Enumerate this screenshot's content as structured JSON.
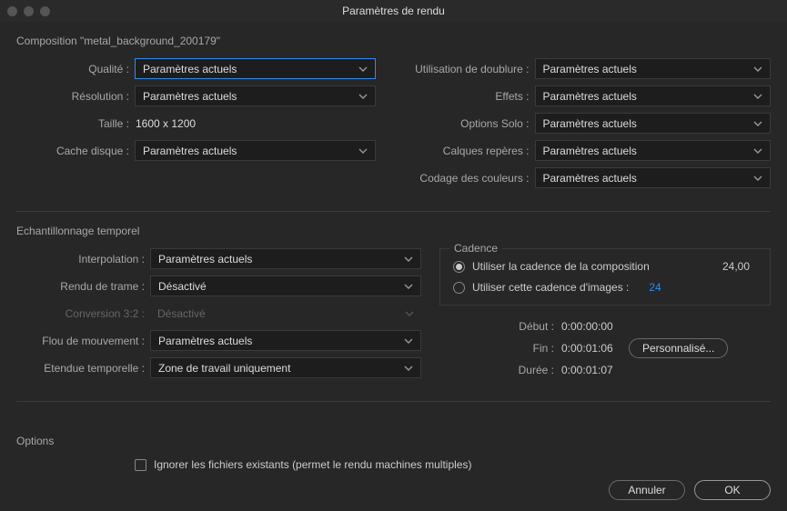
{
  "window_title": "Paramètres de rendu",
  "composition_label": "Composition \"metal_background_200179\"",
  "left_section": {
    "quality_label": "Qualité :",
    "quality_value": "Paramètres actuels",
    "resolution_label": "Résolution :",
    "resolution_value": "Paramètres actuels",
    "size_label": "Taille :",
    "size_value": "1600 x 1200",
    "disk_cache_label": "Cache disque :",
    "disk_cache_value": "Paramètres actuels"
  },
  "right_section": {
    "proxy_label": "Utilisation de doublure :",
    "proxy_value": "Paramètres actuels",
    "effects_label": "Effets :",
    "effects_value": "Paramètres actuels",
    "solo_label": "Options Solo :",
    "solo_value": "Paramètres actuels",
    "guides_label": "Calques repères :",
    "guides_value": "Paramètres actuels",
    "color_label": "Codage des couleurs :",
    "color_value": "Paramètres actuels"
  },
  "temporal": {
    "title": "Echantillonnage temporel",
    "interpolation_label": "Interpolation :",
    "interpolation_value": "Paramètres actuels",
    "field_render_label": "Rendu de trame :",
    "field_render_value": "Désactivé",
    "conversion_label": "Conversion 3:2 :",
    "conversion_value": "Désactivé",
    "motion_blur_label": "Flou de mouvement :",
    "motion_blur_value": "Paramètres actuels",
    "time_span_label": "Etendue temporelle :",
    "time_span_value": "Zone de travail uniquement"
  },
  "cadence": {
    "legend": "Cadence",
    "use_comp_label": "Utiliser la cadence de la composition",
    "use_comp_value": "24,00",
    "use_this_label": "Utiliser cette cadence d'images :",
    "use_this_value": "24"
  },
  "timing": {
    "start_label": "Début :",
    "start_value": "0:00:00:00",
    "end_label": "Fin :",
    "end_value": "0:00:01:06",
    "custom_button": "Personnalisé...",
    "duration_label": "Durée :",
    "duration_value": "0:00:01:07"
  },
  "options": {
    "title": "Options",
    "skip_existing_label": "Ignorer les fichiers existants (permet le rendu machines multiples)"
  },
  "footer": {
    "cancel": "Annuler",
    "ok": "OK"
  }
}
